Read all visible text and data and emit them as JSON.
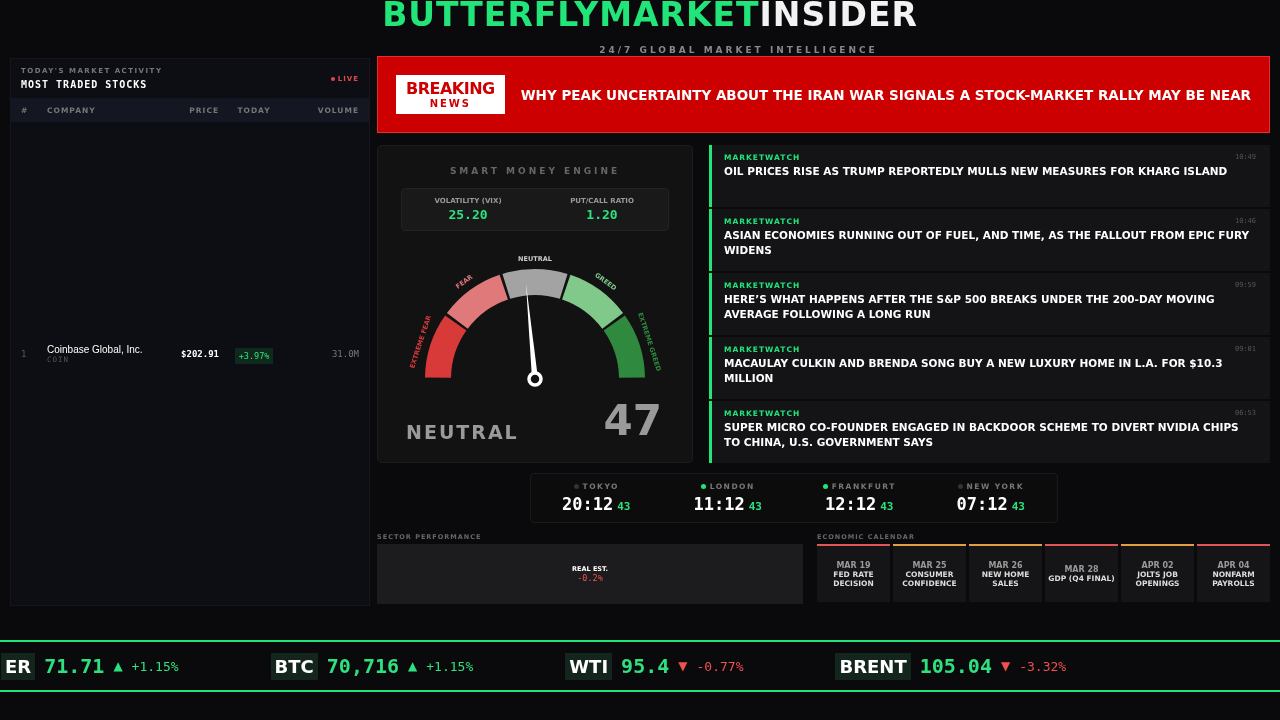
{
  "header": {
    "brand": "BUTTERFLYMARKET",
    "brand_suffix": "INSIDER",
    "tagline": "24/7 GLOBAL MARKET INTELLIGENCE"
  },
  "stocks": {
    "kicker": "TODAY'S MARKET ACTIVITY",
    "title": "MOST TRADED STOCKS",
    "live": "LIVE",
    "columns": [
      "#",
      "COMPANY",
      "PRICE",
      "TODAY",
      "VOLUME"
    ],
    "rows": [
      {
        "rank": "1",
        "company": "Coinbase Global, Inc.",
        "ticker": "COIN",
        "price": "$202.91",
        "change": "+3.97%",
        "volume": "31.0M"
      }
    ]
  },
  "breaking": {
    "badge_top": "BREAKING",
    "badge_bottom": "NEWS",
    "headline": "WHY PEAK UNCERTAINTY ABOUT THE IRAN WAR SIGNALS A STOCK-MARKET RALLY MAY BE NEAR"
  },
  "engine": {
    "title": "SMART MONEY ENGINE",
    "stats": [
      {
        "label": "VOLATILITY (VIX)",
        "value": "25.20"
      },
      {
        "label": "PUT/CALL RATIO",
        "value": "1.20"
      }
    ],
    "zones": [
      {
        "label": "EXTREME FEAR",
        "color": "#d83a3a"
      },
      {
        "label": "FEAR",
        "color": "#e07a7a"
      },
      {
        "label": "NEUTRAL",
        "color": "#a3a3a3"
      },
      {
        "label": "GREED",
        "color": "#80c98b"
      },
      {
        "label": "EXTREME GREED",
        "color": "#2f8a3f"
      }
    ],
    "mood": "NEUTRAL",
    "score": "47"
  },
  "news": [
    {
      "source": "MARKETWATCH",
      "time": "10:49",
      "headline": "OIL PRICES RISE AS TRUMP REPORTEDLY MULLS NEW MEASURES FOR KHARG ISLAND"
    },
    {
      "source": "MARKETWATCH",
      "time": "10:46",
      "headline": "ASIAN ECONOMIES RUNNING OUT OF FUEL, AND TIME, AS THE FALLOUT FROM EPIC FURY WIDENS"
    },
    {
      "source": "MARKETWATCH",
      "time": "09:59",
      "headline": "HERE’S WHAT HAPPENS AFTER THE S&P 500 BREAKS UNDER THE 200-DAY MOVING AVERAGE FOLLOWING A LONG RUN"
    },
    {
      "source": "MARKETWATCH",
      "time": "09:01",
      "headline": "MACAULAY CULKIN AND BRENDA SONG BUY A NEW LUXURY HOME IN L.A. FOR $10.3 MILLION"
    },
    {
      "source": "MARKETWATCH",
      "time": "06:53",
      "headline": "SUPER MICRO CO-FOUNDER ENGAGED IN BACKDOOR SCHEME TO DIVERT NVIDIA CHIPS TO CHINA, U.S. GOVERNMENT SAYS"
    }
  ],
  "clocks": [
    {
      "city": "TOKYO",
      "open": false,
      "time": "20:12",
      "seconds": "43"
    },
    {
      "city": "LONDON",
      "open": true,
      "time": "11:12",
      "seconds": "43"
    },
    {
      "city": "FRANKFURT",
      "open": true,
      "time": "12:12",
      "seconds": "43"
    },
    {
      "city": "NEW YORK",
      "open": false,
      "time": "07:12",
      "seconds": "43"
    }
  ],
  "sectors": {
    "title": "SECTOR PERFORMANCE",
    "items": [
      {
        "name": "REAL EST.",
        "change": "-0.2%"
      }
    ]
  },
  "calendar": {
    "title": "ECONOMIC CALENDAR",
    "events": [
      {
        "date": "MAR 19",
        "name": "FED RATE DECISION",
        "color": "#e05555"
      },
      {
        "date": "MAR 25",
        "name": "CONSUMER CONFIDENCE",
        "color": "#e0a040"
      },
      {
        "date": "MAR 26",
        "name": "NEW HOME SALES",
        "color": "#e0a040"
      },
      {
        "date": "MAR 28",
        "name": "GDP (Q4 FINAL)",
        "color": "#e05555"
      },
      {
        "date": "APR 02",
        "name": "JOLTS JOB OPENINGS",
        "color": "#e0a040"
      },
      {
        "date": "APR 04",
        "name": "NONFARM PAYROLLS",
        "color": "#e05555"
      }
    ]
  },
  "ticker": [
    {
      "symbol": "ER",
      "price": "71.71",
      "arrow": "▲",
      "change": "+1.15%",
      "color": "#2fe07f"
    },
    {
      "symbol": "BTC",
      "price": "70,716",
      "arrow": "▲",
      "change": "+1.15%",
      "color": "#2fe07f"
    },
    {
      "symbol": "WTI",
      "price": "95.4",
      "arrow": "▼",
      "change": "-0.77%",
      "color": "#f05050"
    },
    {
      "symbol": "BRENT",
      "price": "105.04",
      "arrow": "▼",
      "change": "-3.32%",
      "color": "#f05050"
    }
  ]
}
